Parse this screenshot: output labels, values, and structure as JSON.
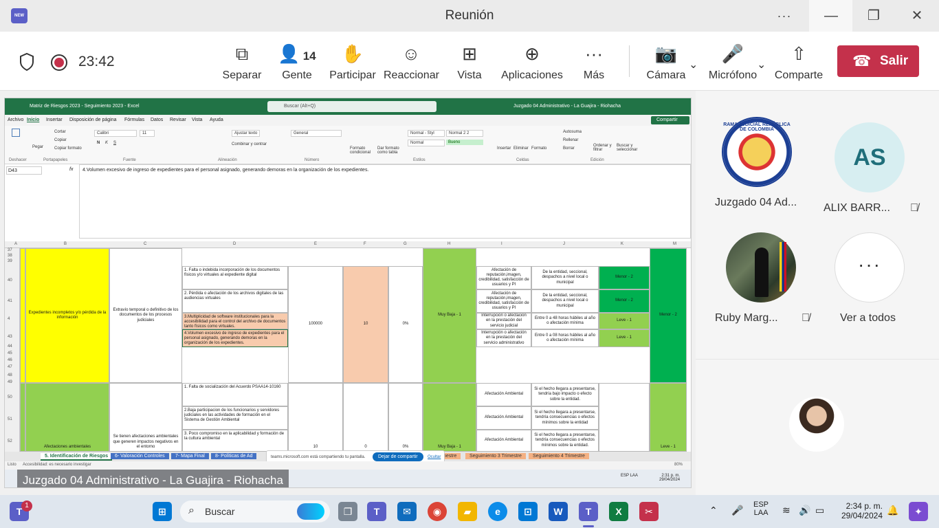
{
  "window": {
    "title": "Reunión",
    "more_label": "···",
    "minimize_label": "—",
    "maximize_label": "❐",
    "close_label": "✕",
    "teams_badge": "NEW"
  },
  "toolbar": {
    "timer": "23:42",
    "buttons": [
      {
        "label": "Separar",
        "icon": "⧉"
      },
      {
        "label": "Gente",
        "icon": "👤",
        "count": "14"
      },
      {
        "label": "Participar",
        "icon": "✋"
      },
      {
        "label": "Reaccionar",
        "icon": "☺"
      },
      {
        "label": "Vista",
        "icon": "⊞"
      },
      {
        "label": "Aplicaciones",
        "icon": "⊕"
      },
      {
        "label": "Más",
        "icon": "···"
      },
      {
        "label": "Cámara",
        "icon": "📷"
      },
      {
        "label": "Micrófono",
        "icon": "🎤"
      },
      {
        "label": "Comparte",
        "icon": "⇧"
      }
    ],
    "leave_label": "Salir",
    "leave_color": "#c4314b"
  },
  "excel": {
    "title": "Matriz de Riesgos 2023 - Seguimiento 2023 - Excel",
    "search_placeholder": "Buscar (Alt+Q)",
    "account": "Juzgado 04 Administrativo - La Guajira - Riohacha",
    "menu": [
      "Archivo",
      "Inicio",
      "Insertar",
      "Disposición de página",
      "Fórmulas",
      "Datos",
      "Revisar",
      "Vista",
      "Ayuda"
    ],
    "share_label": "Compartir",
    "ribbon": {
      "font_name": "Calibri",
      "font_size": "11",
      "wrap_text": "Ajustar texto",
      "merge": "Combinar y centrar",
      "number_format": "General",
      "styles": [
        "Normal - Styl",
        "Normal 2 2",
        "Normal",
        "Bueno"
      ],
      "buttons": [
        "Pegar",
        "Cortar",
        "Copiar",
        "Copiar formato",
        "Formato condicional",
        "Dar formato como tabla",
        "Insertar",
        "Eliminar",
        "Formato",
        "Autosuma",
        "Rellenar",
        "Borrar",
        "Ordenar y filtrar",
        "Buscar y seleccionar"
      ],
      "groups": [
        "Deshacer",
        "Portapapeles",
        "Fuente",
        "Alineación",
        "Número",
        "Estilos",
        "Celdas",
        "Edición"
      ]
    },
    "name_box": "D43",
    "formula": "4.Volumen excesivo de ingreso de expedientes para el personal asignado,  generando demoras en la organización de los expedientes.",
    "columns": [
      "A",
      "B",
      "C",
      "D",
      "E",
      "F",
      "G",
      "H",
      "I",
      "J",
      "K",
      "M"
    ],
    "rows": [
      "37",
      "38",
      "39",
      "40",
      "41",
      "4",
      "43",
      "44",
      "45",
      "46",
      "47",
      "48",
      "49",
      "50",
      "51",
      "52"
    ],
    "cells": {
      "b_risk1": "Expedientes incompletos y/o pérdida de la información",
      "c_risk1": "Extravío temporal o definitivo de los  documentos de los procesos judiciales",
      "d1": "1. Falta o indebida incorporación de los documentos físicos y/o virtuales al expediente digital",
      "d2": "2. Pérdida o afectación de los archivos digitales de las audiencias virtuales",
      "d3": "3.Multiplicidad de software institucionales para la accesibilidad para el control del archivo de documentos tanto físicos como virtuales.",
      "d4": "4.Volumen excesivo de ingreso de expedientes para el personal asignado,  generando demoras en la organización de los expedientes.",
      "e1": "100000",
      "f1": "10",
      "g1": "0%",
      "h1": "Muy Baja - 1",
      "i1": "Afectación de reputación,imagen, credibilidad, satisfacción de usuarios y PI",
      "i2": "Afectación de reputación,imagen, credibilidad, satisfacción de usuarios y PI",
      "i3": "Interrupción o afectación en la prestación del servicio judicial",
      "i4": "Interrupción o afectación en la prestación del servicio administrativo",
      "j1": "De la entidad, seccional, despachos a nivel local o municipal",
      "j2": "De la entidad, seccional, despachos a nivel local o municipal",
      "j3": "Entre 0 a 48 horas hábiles al año o afectación mínima",
      "j4": "Entre 0 a 08 horas hábiles al año o afectación mínima",
      "k1": "Menor - 2",
      "k2": "Menor - 2",
      "k3": "Leve - 1",
      "k4": "Leve - 1",
      "m1": "Menor - 2",
      "b_risk2": "Afectaciones ambientales",
      "c_risk2": "Se tienen   afectaciones ambientales que generen impactos negativos en el entorno",
      "d5": "1. Falta de socialización del Acuerdo PSAA14-10160",
      "d6": "2.Baja participacion de los funcionarios y servidores judiciales en las actividades de formación en el Sistema de Gestión Ambiental",
      "d7": "3.  Poco compromiso en la aplicabilidad y formación de la cultura ambiental",
      "e2": "10",
      "f2": "0",
      "g2": "0%",
      "h2": "Muy Baja - 1",
      "i5": "Afectación Ambiental",
      "i6": "Afectación Ambiental",
      "i7": "Afectación Ambiental",
      "j5": "Si el hecho llegara a presentarse, tendría bajo impacto o efecto sobre la entidad.",
      "j6": "Si el hecho llegara a presentarse, tendría consecuencias o efectos mínimos sobre la entidad",
      "j7": "Si el hecho llegara a presentarse, tendría consecuencias o efectos mínimos sobre la entidad.",
      "m2": "Leve - 1"
    },
    "tabs": [
      "5. Identificación de Riesgos",
      "6- Valoración Controles",
      "7- Mapa Final",
      "8- Políticas de Ad",
      "Seguimiento 3 Trimestre",
      "Seguimiento 4 Trimestre"
    ],
    "tab_partial": "mestre",
    "share_banner": {
      "message": "teams.microsoft.com está compartiendo tu pantalla.",
      "stop": "Dejar de compartir",
      "hide": "Ocultar"
    },
    "status": "Listo",
    "accessibility": "Accesibilidad: es necesario investigar",
    "zoom": "80%",
    "inner_clock_time": "2:31 p. m.",
    "inner_clock_date": "29/04/2024",
    "inner_lang": "ESP LAA"
  },
  "presenter_label": "Juzgado 04 Administrativo - La Guajira - Riohacha",
  "participants": [
    {
      "name": "Juzgado 04 Ad...",
      "seal_text": "RAMA JUDICIAL REPÚBLICA DE COLOMBIA"
    },
    {
      "name": "ALIX BARR...",
      "initials": "AS",
      "muted": "🎙̸"
    },
    {
      "name": "Ruby Marg...",
      "muted": "🎙̸"
    },
    {
      "name": "Ver a todos",
      "icon": "···"
    }
  ],
  "taskbar": {
    "search": "Buscar",
    "teams_badge": "1",
    "lang_top": "ESP",
    "lang_bottom": "LAA",
    "time": "2:34 p. m.",
    "date": "29/04/2024"
  }
}
